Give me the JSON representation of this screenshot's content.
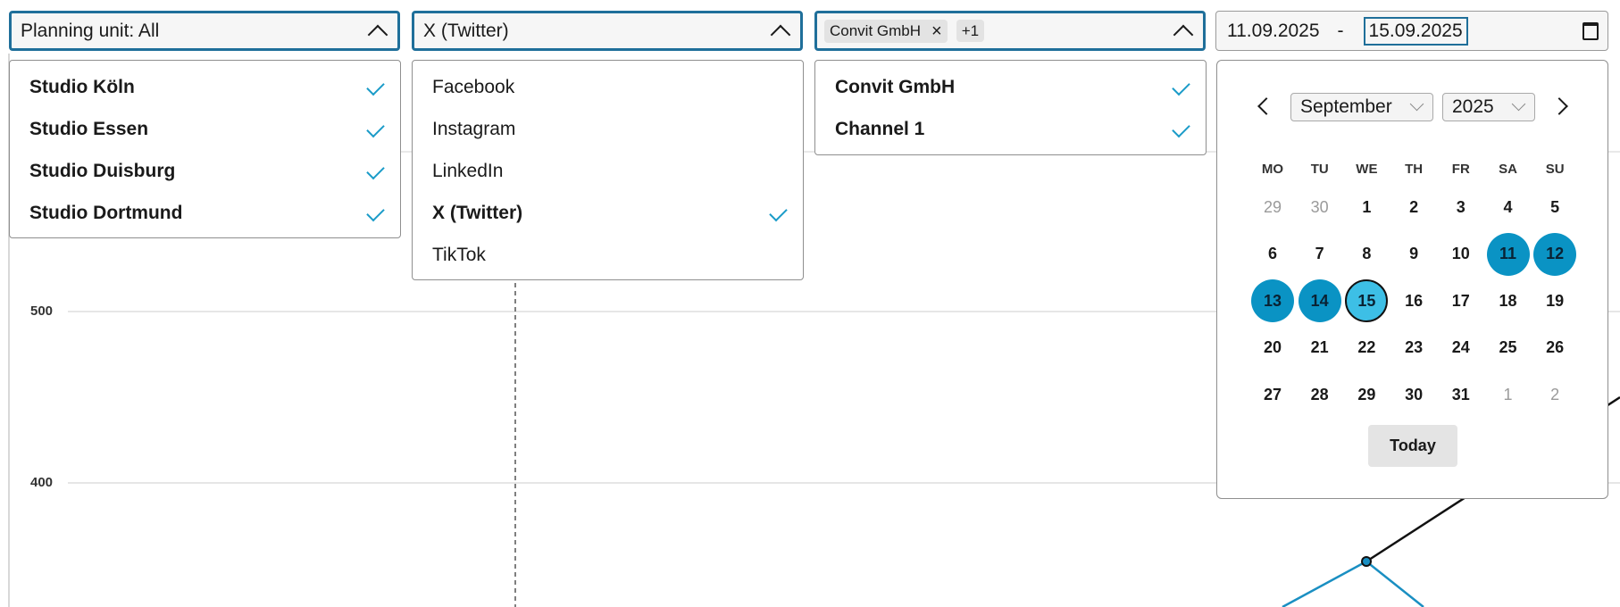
{
  "filters": {
    "planning_unit": {
      "label": "Planning unit: All",
      "options": [
        {
          "label": "Studio Köln",
          "selected": true
        },
        {
          "label": "Studio Essen",
          "selected": true
        },
        {
          "label": "Studio Duisburg",
          "selected": true
        },
        {
          "label": "Studio Dortmund",
          "selected": true
        }
      ]
    },
    "network": {
      "label": "X (Twitter)",
      "options": [
        {
          "label": "Facebook",
          "selected": false
        },
        {
          "label": "Instagram",
          "selected": false
        },
        {
          "label": "LinkedIn",
          "selected": false
        },
        {
          "label": "X (Twitter)",
          "selected": true
        },
        {
          "label": "TikTok",
          "selected": false
        }
      ]
    },
    "channel": {
      "chip": "Convit GmbH",
      "chip_remove": "×",
      "more": "+1",
      "options": [
        {
          "label": "Convit GmbH",
          "selected": true
        },
        {
          "label": "Channel 1",
          "selected": true
        }
      ]
    },
    "date_range": {
      "start": "11.09.2025",
      "separator": "-",
      "end": "15.09.2025",
      "icon": "calendar-icon"
    }
  },
  "calendar": {
    "month": "September",
    "year": "2025",
    "weekdays": [
      "MO",
      "TU",
      "WE",
      "TH",
      "FR",
      "SA",
      "SU"
    ],
    "weeks": [
      [
        {
          "d": "29",
          "m": true
        },
        {
          "d": "30",
          "m": true
        },
        {
          "d": "1"
        },
        {
          "d": "2"
        },
        {
          "d": "3"
        },
        {
          "d": "4"
        },
        {
          "d": "5"
        }
      ],
      [
        {
          "d": "6"
        },
        {
          "d": "7"
        },
        {
          "d": "8"
        },
        {
          "d": "9"
        },
        {
          "d": "10"
        },
        {
          "d": "11",
          "s": "range"
        },
        {
          "d": "12",
          "s": "range"
        }
      ],
      [
        {
          "d": "13",
          "s": "range"
        },
        {
          "d": "14",
          "s": "range"
        },
        {
          "d": "15",
          "s": "end"
        },
        {
          "d": "16"
        },
        {
          "d": "17"
        },
        {
          "d": "18"
        },
        {
          "d": "19"
        }
      ],
      [
        {
          "d": "20"
        },
        {
          "d": "21"
        },
        {
          "d": "22"
        },
        {
          "d": "23"
        },
        {
          "d": "24"
        },
        {
          "d": "25"
        },
        {
          "d": "26"
        }
      ],
      [
        {
          "d": "27"
        },
        {
          "d": "28"
        },
        {
          "d": "29"
        },
        {
          "d": "30"
        },
        {
          "d": "31"
        },
        {
          "d": "1",
          "m": true
        },
        {
          "d": "2",
          "m": true
        }
      ]
    ],
    "today_label": "Today"
  },
  "chart": {
    "y_ticks": [
      "500",
      "400"
    ],
    "colors": {
      "grid": "#dddddd",
      "series_dark": "#111111",
      "series_blue": "#1a8fc2",
      "marker": "#1a8fc2"
    }
  }
}
